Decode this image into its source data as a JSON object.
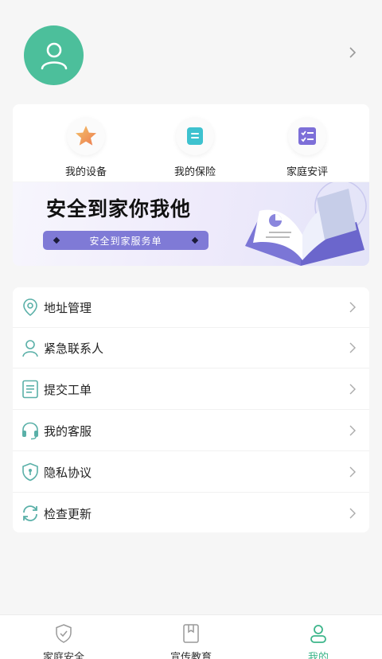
{
  "profile": {
    "avatar_icon": "user-icon",
    "chevron_icon": "chevron-right-icon"
  },
  "quick_actions": [
    {
      "label": "我的设备",
      "icon": "star-icon"
    },
    {
      "label": "我的保险",
      "icon": "document-icon"
    },
    {
      "label": "家庭安评",
      "icon": "checklist-icon"
    }
  ],
  "banner": {
    "title": "安全到家你我他",
    "button_label": "安全到家服务单"
  },
  "menu": [
    {
      "label": "地址管理",
      "icon": "location-pin-icon"
    },
    {
      "label": "紧急联系人",
      "icon": "contact-person-icon"
    },
    {
      "label": "提交工单",
      "icon": "work-order-icon"
    },
    {
      "label": "我的客服",
      "icon": "headset-icon"
    },
    {
      "label": "隐私协议",
      "icon": "shield-lock-icon"
    },
    {
      "label": "检查更新",
      "icon": "refresh-icon"
    }
  ],
  "tabs": [
    {
      "label": "家庭安全",
      "icon": "shield-check-icon",
      "active": false
    },
    {
      "label": "宣传教育",
      "icon": "book-icon",
      "active": false
    },
    {
      "label": "我的",
      "icon": "person-icon",
      "active": true
    }
  ],
  "colors": {
    "accent": "#4cbf9b",
    "banner_button": "#7f7ad6",
    "icon_teal": "#5ab0a8",
    "active_tab": "#3cb58a"
  }
}
